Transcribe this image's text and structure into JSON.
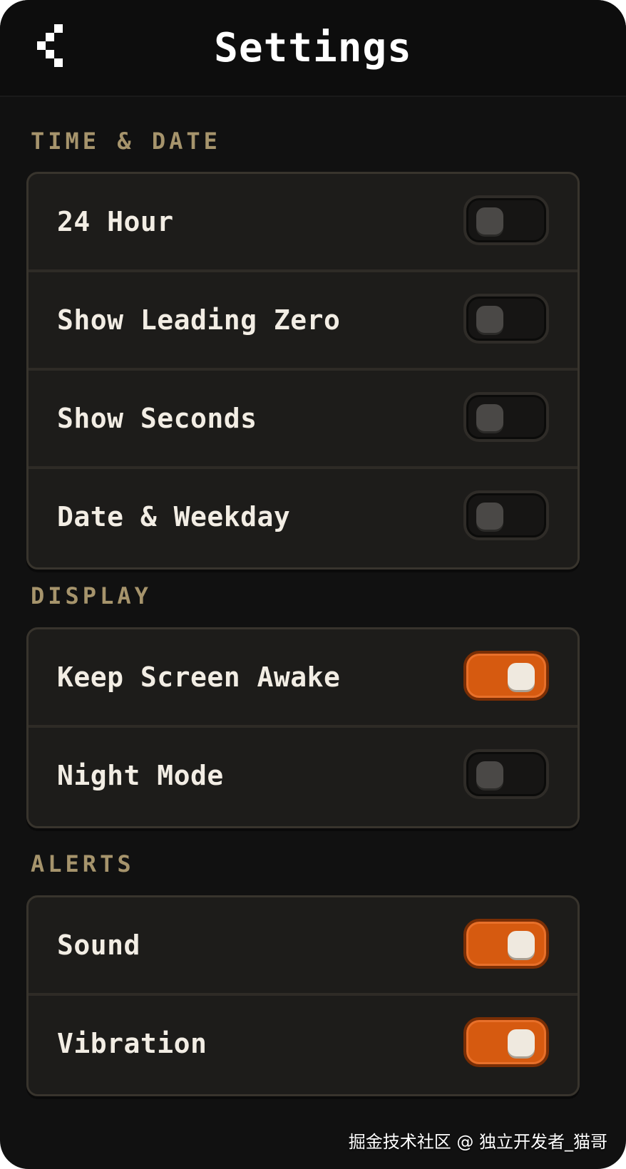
{
  "header": {
    "title": "Settings",
    "back_icon": "chevron-left-icon"
  },
  "sections": [
    {
      "title": "TIME & DATE",
      "items": [
        {
          "label": "24 Hour",
          "on": false
        },
        {
          "label": "Show Leading Zero",
          "on": false
        },
        {
          "label": "Show Seconds",
          "on": false
        },
        {
          "label": "Date & Weekday",
          "on": false
        }
      ]
    },
    {
      "title": "DISPLAY",
      "items": [
        {
          "label": "Keep Screen Awake",
          "on": true
        },
        {
          "label": "Night Mode",
          "on": false
        }
      ]
    },
    {
      "title": "ALERTS",
      "items": [
        {
          "label": "Sound",
          "on": true
        },
        {
          "label": "Vibration",
          "on": true
        }
      ]
    }
  ],
  "watermark": "掘金技术社区 @ 独立开发者_猫哥",
  "colors": {
    "background": "#111111",
    "section_title": "#a6946c",
    "card_background": "#1d1c1a",
    "card_border": "#38342d",
    "toggle_on": "#d65a10",
    "toggle_off": "#161514",
    "label_text": "#f2ede4"
  }
}
